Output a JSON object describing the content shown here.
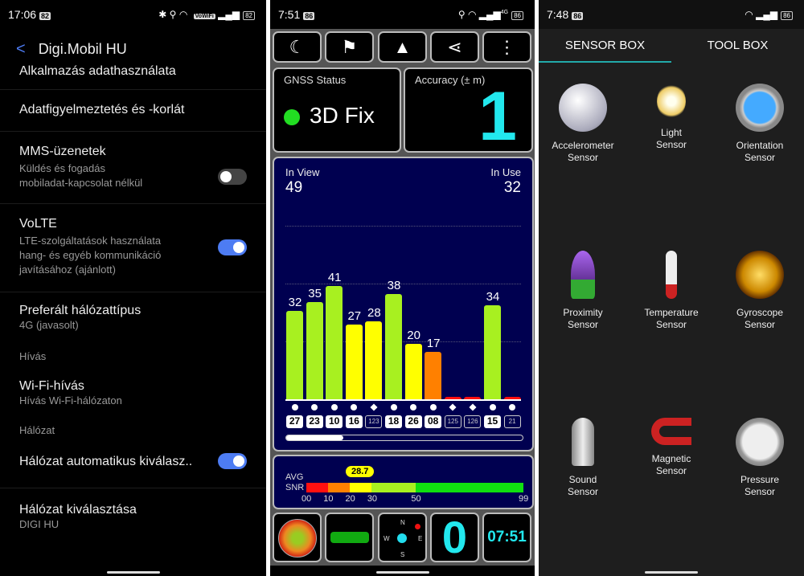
{
  "left": {
    "status": {
      "time": "17:06",
      "badge": "82",
      "battery": "82",
      "icons": [
        "bluetooth-icon",
        "location-icon",
        "wifi-icon",
        "vowifi-icon",
        "signal-icon",
        "battery-icon"
      ],
      "vowifi": "VoWiFi"
    },
    "title": "Digi.Mobil HU",
    "items": [
      {
        "title": "Alkalmazás adathasználata"
      },
      {
        "title": "Adatfigyelmeztetés és -korlát"
      },
      {
        "title": "MMS-üzenetek",
        "subtitle": "Küldés és fogadás\nmobiladat-kapcsolat nélkül",
        "toggle": false
      },
      {
        "title": "VoLTE",
        "subtitle": "LTE-szolgáltatások használata\nhang- és egyéb kommunikáció\njavításához (ajánlott)",
        "toggle": true
      },
      {
        "title": "Preferált hálózattípus",
        "subtitle": "4G (javasolt)"
      }
    ],
    "section_call": "Hívás",
    "wifi_call": {
      "title": "Wi-Fi-hívás",
      "subtitle": "Hívás Wi-Fi-hálózaton"
    },
    "section_network": "Hálózat",
    "auto_network": {
      "title": "Hálózat automatikus kiválasz..",
      "toggle": true
    },
    "select_network": {
      "title": "Hálózat kiválasztása",
      "subtitle": "DIGI HU"
    }
  },
  "middle": {
    "status": {
      "time": "7:51",
      "badge": "86",
      "battery": "86",
      "network": "4G"
    },
    "toolbar": [
      "moon-icon",
      "person-flag-icon",
      "navigation-arrow-icon",
      "share-icon",
      "more-vert-icon"
    ],
    "gnss_label": "GNSS Status",
    "gnss_value": "3D Fix",
    "fix_color": "#22dd22",
    "accuracy_label": "Accuracy (± m)",
    "accuracy_value": "1",
    "in_view_label": "In View",
    "in_view": "49",
    "in_use_label": "In Use",
    "in_use": "32",
    "satellites": [
      {
        "id": "27",
        "snr": 32,
        "used": true,
        "shape": "dot"
      },
      {
        "id": "23",
        "snr": 35,
        "used": true,
        "shape": "dot"
      },
      {
        "id": "10",
        "snr": 41,
        "used": true,
        "shape": "dot"
      },
      {
        "id": "16",
        "snr": 27,
        "used": true,
        "shape": "dot"
      },
      {
        "id": "123",
        "snr": 28,
        "used": false,
        "shape": "diamond"
      },
      {
        "id": "18",
        "snr": 38,
        "used": true,
        "shape": "dot"
      },
      {
        "id": "26",
        "snr": 20,
        "used": true,
        "shape": "dot"
      },
      {
        "id": "08",
        "snr": 17,
        "used": true,
        "shape": "dot"
      },
      {
        "id": "125",
        "snr": 0,
        "used": false,
        "shape": "diamond"
      },
      {
        "id": "126",
        "snr": 0,
        "used": false,
        "shape": "diamond"
      },
      {
        "id": "15",
        "snr": 34,
        "used": true,
        "shape": "dot"
      },
      {
        "id": "21",
        "snr": 0,
        "used": false,
        "shape": "dot"
      }
    ],
    "scroll_fraction": 0.24,
    "avg_label": "AVG",
    "snr_label": "SNR",
    "avg_snr": "28.7",
    "snr_ticks": [
      "00",
      "10",
      "20",
      "30",
      "50",
      "99"
    ],
    "colors": {
      "red": "#ff1010",
      "orange": "#ff8000",
      "yellow": "#ffff00",
      "lime": "#a8f020",
      "green": "#10e010",
      "accent": "#22e8ee"
    },
    "bottom": {
      "icons": [
        "sky-view-icon",
        "world-map-icon",
        "compass-icon"
      ],
      "compass": [
        "N",
        "E",
        "S",
        "W"
      ],
      "count": "0",
      "clock": "07:51"
    }
  },
  "right": {
    "status": {
      "time": "7:48",
      "badge": "86",
      "battery": "86"
    },
    "tabs": [
      "SENSOR BOX",
      "TOOL BOX"
    ],
    "sensors": [
      {
        "name": "Accelerometer",
        "sub": "Sensor",
        "icon": "sphere-icon"
      },
      {
        "name": "Light",
        "sub": "Sensor",
        "icon": "lightbulb-icon"
      },
      {
        "name": "Orientation",
        "sub": "Sensor",
        "icon": "compass-icon"
      },
      {
        "name": "Proximity",
        "sub": "Sensor",
        "icon": "crocus-flower-icon"
      },
      {
        "name": "Temperature",
        "sub": "Sensor",
        "icon": "thermometer-icon"
      },
      {
        "name": "Gyroscope",
        "sub": "Sensor",
        "icon": "gyroscope-icon"
      },
      {
        "name": "Sound",
        "sub": "Sensor",
        "icon": "microphone-icon"
      },
      {
        "name": "Magnetic",
        "sub": "Sensor",
        "icon": "magnet-icon"
      },
      {
        "name": "Pressure",
        "sub": "Sensor",
        "icon": "barometer-icon"
      }
    ]
  }
}
